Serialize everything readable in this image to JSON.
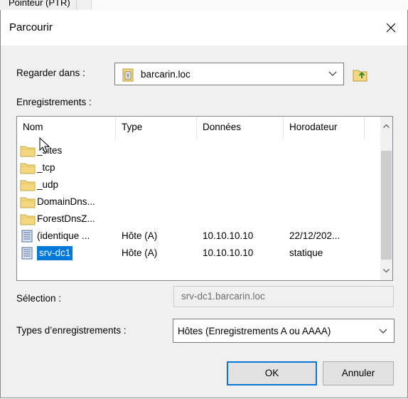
{
  "background_window": {
    "tab_label": "Pointeur (PTR)"
  },
  "dialog": {
    "title": "Parcourir",
    "look_in": {
      "label": "Regarder dans :",
      "value": "barcarin.loc"
    },
    "records_label": "Enregistrements :",
    "columns": [
      "Nom",
      "Type",
      "Données",
      "Horodateur"
    ],
    "rows": [
      {
        "icon": "folder-icon",
        "name": "_sites",
        "type": "",
        "data": "",
        "timestamp": "",
        "selected": false
      },
      {
        "icon": "folder-icon",
        "name": "_tcp",
        "type": "",
        "data": "",
        "timestamp": "",
        "selected": false
      },
      {
        "icon": "folder-icon",
        "name": "_udp",
        "type": "",
        "data": "",
        "timestamp": "",
        "selected": false
      },
      {
        "icon": "folder-icon",
        "name": "DomainDns...",
        "type": "",
        "data": "",
        "timestamp": "",
        "selected": false
      },
      {
        "icon": "folder-icon",
        "name": "ForestDnsZ...",
        "type": "",
        "data": "",
        "timestamp": "",
        "selected": false
      },
      {
        "icon": "record-icon",
        "name": "(identique ...",
        "type": "Hôte (A)",
        "data": "10.10.10.10",
        "timestamp": "22/12/202...",
        "selected": false
      },
      {
        "icon": "record-icon",
        "name": "srv-dc1",
        "type": "Hôte (A)",
        "data": "10.10.10.10",
        "timestamp": "statique",
        "selected": true
      }
    ],
    "selection": {
      "label": "Sélection :",
      "value": "srv-dc1.barcarin.loc"
    },
    "record_types": {
      "label": "Types d’enregistrements :",
      "value": "Hôtes (Enregistrements A ou AAAA)"
    },
    "ok_label": "OK",
    "cancel_label": "Annuler"
  },
  "colors": {
    "selection": "#0078d7",
    "dialog_bg": "#f0f0f0",
    "folder": "#f4d77e"
  }
}
